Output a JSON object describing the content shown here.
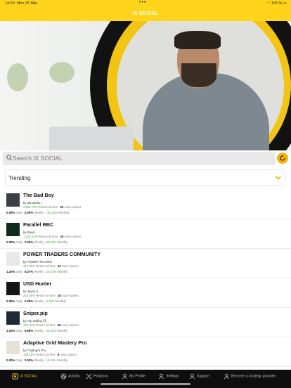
{
  "status_bar": {
    "time": "14:00",
    "date": "Mon 25 Mar",
    "battery": "100 %"
  },
  "header": {
    "title": "IX SOCIAL"
  },
  "search": {
    "placeholder": "Search IX SOCIAL"
  },
  "filter": {
    "selected": "Trending"
  },
  "strategies": [
    {
      "name": "The Bad Boy",
      "by": "alexander l",
      "return_all_time": "3,521.76%",
      "return_label": "Return all time",
      "auto_copiers": "25",
      "auto_label": "Auto-copiers",
      "daily": "0.00%",
      "weekly": "0.00%",
      "monthly": "191.31%",
      "avatar_color": "#3a3f44"
    },
    {
      "name": "Parallel RBC",
      "by": "Ravel",
      "return_all_time": "1,304.31%",
      "return_label": "Return all time",
      "auto_copiers": "26",
      "auto_label": "Auto-copiers",
      "daily": "0.00%",
      "weekly": "0.00%",
      "monthly": "80.02%",
      "avatar_color": "#0f2b1f"
    },
    {
      "name": "POWER TRADERS COMMUNITY",
      "by": "POWER TRADER",
      "return_all_time": "317.69%",
      "return_label": "Return all time",
      "auto_copiers": "34",
      "auto_label": "Auto-copiers",
      "daily": "1.20%",
      "weekly": "8.37%",
      "monthly": "34.33%",
      "avatar_color": "#e8e8e8"
    },
    {
      "name": "USD Hunter",
      "by": "dayne a",
      "return_all_time": "224.59%",
      "return_label": "Return all time",
      "auto_copiers": "18",
      "auto_label": "Auto-copiers",
      "daily": "0.00%",
      "weekly": "0.00%",
      "monthly": "8.18%",
      "avatar_color": "#151515"
    },
    {
      "name": "Sniper.pip",
      "by": "Top trading 💱",
      "return_all_time": "129.37%",
      "return_label": "Return all time",
      "auto_copiers": "55",
      "auto_label": "Auto-copiers",
      "daily": "1.16%",
      "weekly": "8.68%",
      "monthly": "32.32%",
      "avatar_color": "#1f2a36"
    },
    {
      "name": "Adaptive Grid Mastery Pro",
      "by": "TradingAI Pro",
      "return_all_time": "109.15%",
      "return_label": "Return all time",
      "auto_copiers": "9",
      "auto_label": "Auto-copiers",
      "daily": "0.00%",
      "weekly": "0.00%",
      "monthly": "18.16%",
      "avatar_color": "#e6e0d6"
    }
  ],
  "labels": {
    "by": "by",
    "daily": "Daily",
    "weekly": "Weekly",
    "monthly": "Monthly"
  },
  "bottom_nav": [
    {
      "label": "IX SOCIAL",
      "icon": "ix-social-icon",
      "active": true
    },
    {
      "label": "Activity",
      "icon": "activity-icon",
      "active": false
    },
    {
      "label": "Positions",
      "icon": "positions-icon",
      "active": false
    },
    {
      "label": "My Profile",
      "icon": "profile-icon",
      "active": false
    },
    {
      "label": "Settings",
      "icon": "settings-icon",
      "active": false
    },
    {
      "label": "Support",
      "icon": "support-icon",
      "active": false
    },
    {
      "label": "Become a strategy provider",
      "icon": "provider-icon",
      "active": false
    }
  ],
  "colors": {
    "brand_yellow": "#ffd41a",
    "accent": "#f2c413",
    "positive": "#3caa3c",
    "nav_bg": "#0e0e0e"
  }
}
